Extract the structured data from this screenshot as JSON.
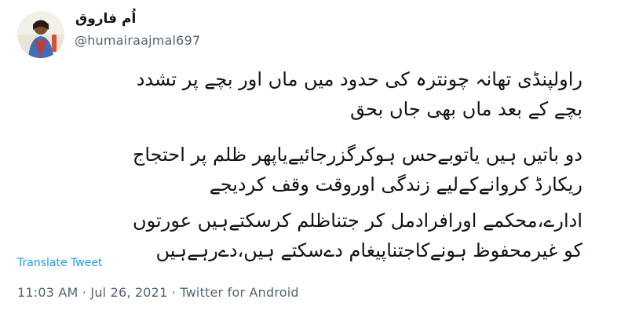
{
  "author": {
    "display_name": "اُم فاروق",
    "handle": "@humairaajmal697"
  },
  "tweet": {
    "paragraphs": [
      [
        "راولپنڈی تھانہ چونترہ کی حدود میں ماں اور بچے پر تشدد",
        "بچے کے بعد ماں بھی جاں بحق"
      ],
      [
        "دو باتیں ہیں یاتوبےحس ہوکرگزرجائیےیاپھر ظلم پر احتجاج",
        "ریکارڈ کروانےکےلیے زندگی اوروقت وقف کردیجے"
      ],
      [
        "ادارے،محکمے اورافرادمل کر جتناظلم کرسکتےہیں عورتوں",
        "کو غیرمحفوظ ہونےکاجتناپیغام دےسکتے ہیں،دےرہےہیں"
      ]
    ],
    "translate_label": "Translate Tweet"
  },
  "meta": {
    "time": "11:03 AM",
    "date": "Jul 26, 2021",
    "separator": " · ",
    "source": "Twitter for Android"
  }
}
